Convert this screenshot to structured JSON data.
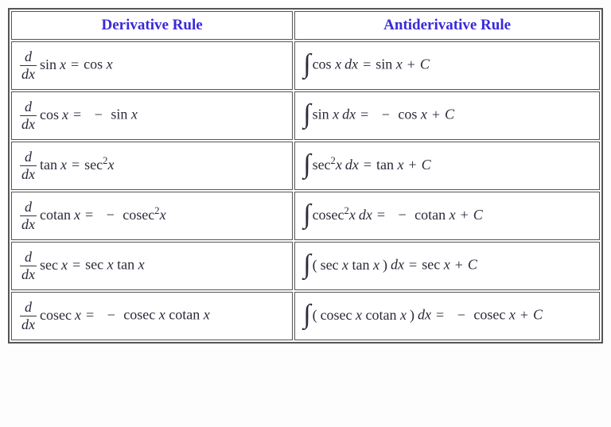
{
  "headers": {
    "derivative": "Derivative Rule",
    "antiderivative": "Antiderivative Rule"
  },
  "rows": [
    {
      "d_func": "sin",
      "d_result": "cos x",
      "d_neg": false,
      "d_sq": false,
      "a_integrand": "cos x",
      "a_parens": false,
      "a_sq": false,
      "a_result": "sin x",
      "a_neg": false
    },
    {
      "d_func": "cos",
      "d_result": "sin x",
      "d_neg": true,
      "d_sq": false,
      "a_integrand": "sin x",
      "a_parens": false,
      "a_sq": false,
      "a_result": "cos x",
      "a_neg": true
    },
    {
      "d_func": "tan",
      "d_result": "sec",
      "d_neg": false,
      "d_sq": true,
      "a_integrand": "sec",
      "a_parens": false,
      "a_sq": true,
      "a_result": "tan x",
      "a_neg": false
    },
    {
      "d_func": "cotan",
      "d_result": "cosec",
      "d_neg": true,
      "d_sq": true,
      "a_integrand": "cosec",
      "a_parens": false,
      "a_sq": true,
      "a_result": "cotan x",
      "a_neg": true
    },
    {
      "d_func": "sec",
      "d_result": "sec x tan x",
      "d_neg": false,
      "d_sq": false,
      "a_integrand": "sec x tan x",
      "a_parens": true,
      "a_sq": false,
      "a_result": "sec x",
      "a_neg": false
    },
    {
      "d_func": "cosec",
      "d_result": "cosec x cotan x",
      "d_neg": true,
      "d_sq": false,
      "a_integrand": "cosec x cotan x",
      "a_parens": true,
      "a_sq": false,
      "a_result": "cosec x",
      "a_neg": true
    }
  ]
}
